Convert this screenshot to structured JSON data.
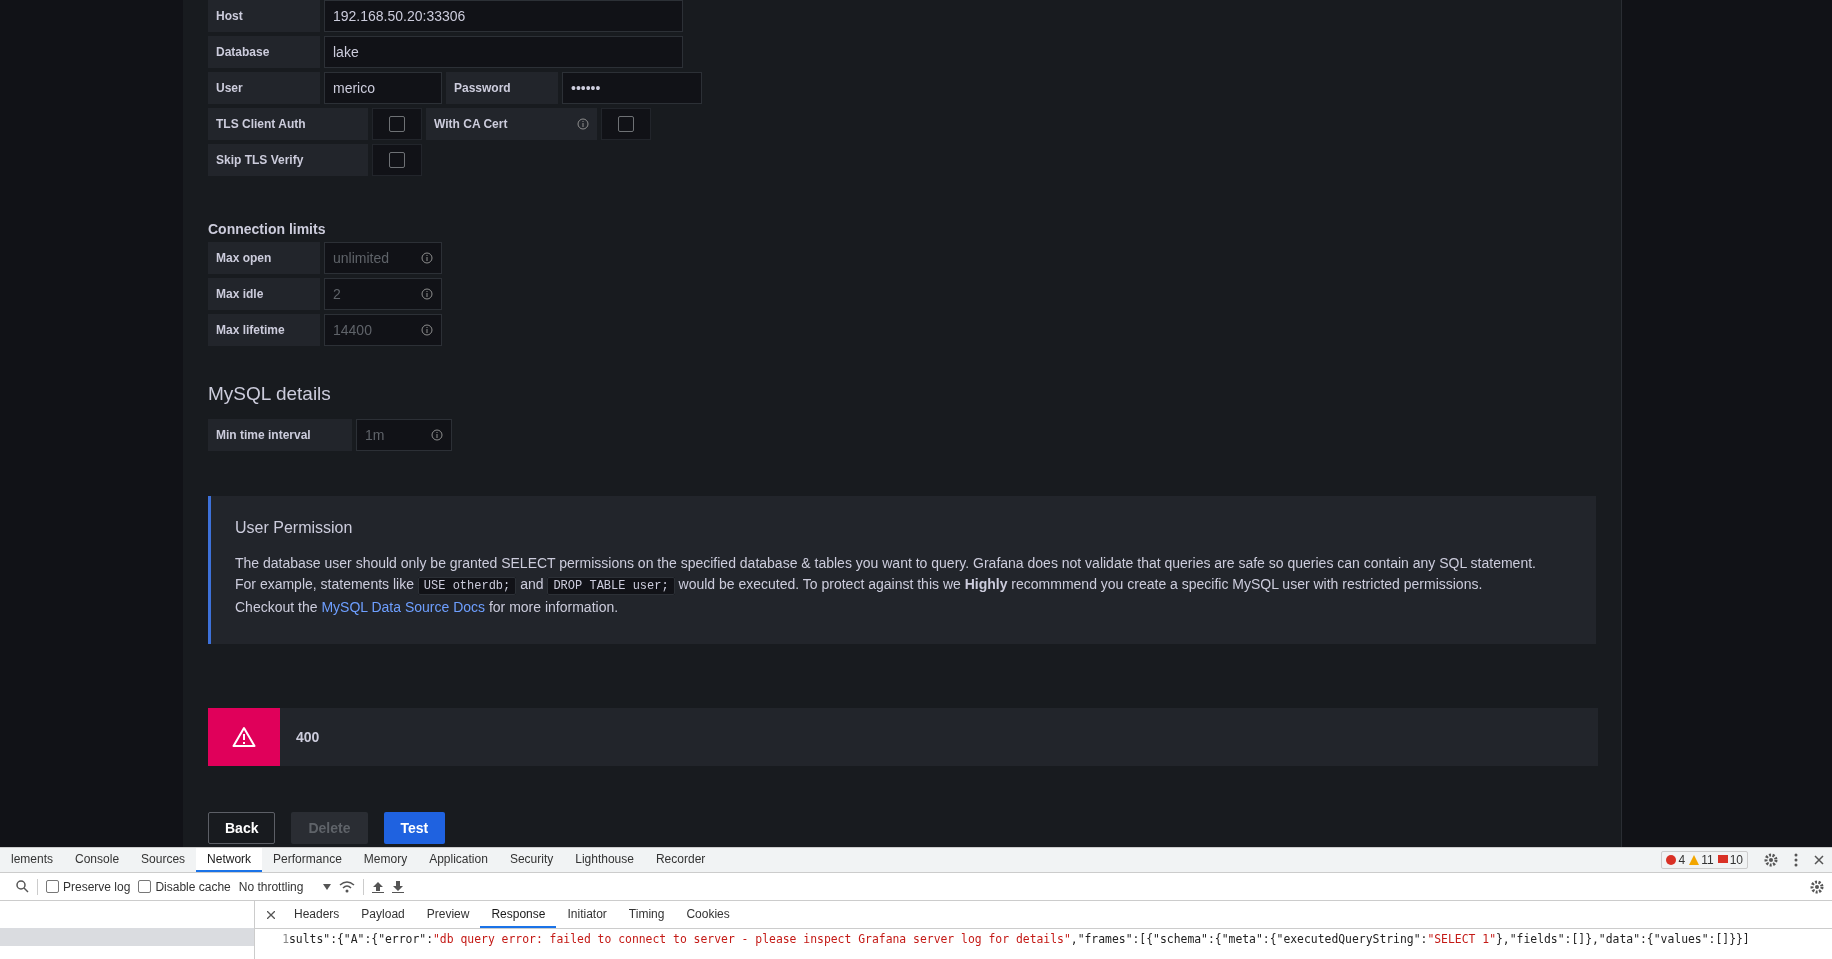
{
  "auth_rows": [
    {
      "fields": [
        {
          "label": "Host",
          "value": "192.168.50.20:33306"
        }
      ]
    },
    {
      "fields": [
        {
          "label": "Database",
          "value": "lake"
        }
      ]
    },
    {
      "fields": [
        {
          "label": "User",
          "value": "merico"
        },
        {
          "label": "Password",
          "value": "••••••"
        }
      ]
    }
  ],
  "tls_options": [
    {
      "label": "TLS Client Auth",
      "checked": false,
      "info": false
    },
    {
      "label": "With CA Cert",
      "checked": false,
      "info": true
    },
    {
      "label": "Skip TLS Verify",
      "checked": false,
      "info": false
    }
  ],
  "connection_limits": {
    "title": "Connection limits",
    "fields": [
      {
        "label": "Max open",
        "placeholder": "unlimited"
      },
      {
        "label": "Max idle",
        "placeholder": "2"
      },
      {
        "label": "Max lifetime",
        "placeholder": "14400"
      }
    ]
  },
  "mysql_details": {
    "title": "MySQL details",
    "fields": [
      {
        "label": "Min time interval",
        "placeholder": "1m"
      }
    ]
  },
  "permission_notice": {
    "title": "User Permission",
    "lines": [
      [
        {
          "kind": "text",
          "text": "The database user should only be granted SELECT permissions on the specified database & tables you want to query. Grafana does not validate that queries are safe so queries can contain any SQL statement."
        }
      ],
      [
        {
          "kind": "text",
          "text": "For example, statements like "
        },
        {
          "kind": "code",
          "text": "USE otherdb;"
        },
        {
          "kind": "text",
          "text": " and "
        },
        {
          "kind": "code",
          "text": "DROP TABLE user;"
        },
        {
          "kind": "text",
          "text": " would be executed. To protect against this we "
        },
        {
          "kind": "bold",
          "text": "Highly"
        },
        {
          "kind": "text",
          "text": " recommmend you create a specific MySQL user with restricted permissions."
        }
      ],
      [
        {
          "kind": "text",
          "text": "Checkout the "
        },
        {
          "kind": "link",
          "text": "MySQL Data Source Docs"
        },
        {
          "kind": "text",
          "text": " for more information."
        }
      ]
    ]
  },
  "error_alert": {
    "message": "400"
  },
  "buttons": [
    {
      "label": "Back",
      "kind": "secondary",
      "disabled": false
    },
    {
      "label": "Delete",
      "kind": "destructive",
      "disabled": true
    },
    {
      "label": "Test",
      "kind": "primary",
      "disabled": false
    }
  ],
  "devtools": {
    "tabs": [
      {
        "label": "lements",
        "selected": false
      },
      {
        "label": "Console",
        "selected": false
      },
      {
        "label": "Sources",
        "selected": false
      },
      {
        "label": "Network",
        "selected": true
      },
      {
        "label": "Performance",
        "selected": false
      },
      {
        "label": "Memory",
        "selected": false
      },
      {
        "label": "Application",
        "selected": false
      },
      {
        "label": "Security",
        "selected": false
      },
      {
        "label": "Lighthouse",
        "selected": false
      },
      {
        "label": "Recorder",
        "selected": false
      }
    ],
    "counts": [
      {
        "kind": "error",
        "value": "4"
      },
      {
        "kind": "warning",
        "value": "11"
      },
      {
        "kind": "issue",
        "value": "10"
      }
    ],
    "options": [
      {
        "label": "Preserve log",
        "checked": false
      },
      {
        "label": "Disable cache",
        "checked": false
      }
    ],
    "throttling": "No throttling",
    "detail_tabs": [
      {
        "label": "Headers",
        "selected": false
      },
      {
        "label": "Payload",
        "selected": false
      },
      {
        "label": "Preview",
        "selected": false
      },
      {
        "label": "Response",
        "selected": true
      },
      {
        "label": "Initiator",
        "selected": false
      },
      {
        "label": "Timing",
        "selected": false
      },
      {
        "label": "Cookies",
        "selected": false
      }
    ],
    "response": {
      "line_number": "1",
      "segments": [
        {
          "kind": "punct",
          "text": "sults\":{\"A\":{\"error\":"
        },
        {
          "kind": "string",
          "text": "\"db query error: failed to connect to server - please inspect Grafana server log for details\""
        },
        {
          "kind": "punct",
          "text": ",\"frames\":[{\"schema\":{\"meta\":{\"executedQueryString\":"
        },
        {
          "kind": "string",
          "text": "\"SELECT 1\""
        },
        {
          "kind": "punct",
          "text": "},\"fields\":[]},\"data\":{\"values\":[]}}]"
        }
      ]
    }
  }
}
